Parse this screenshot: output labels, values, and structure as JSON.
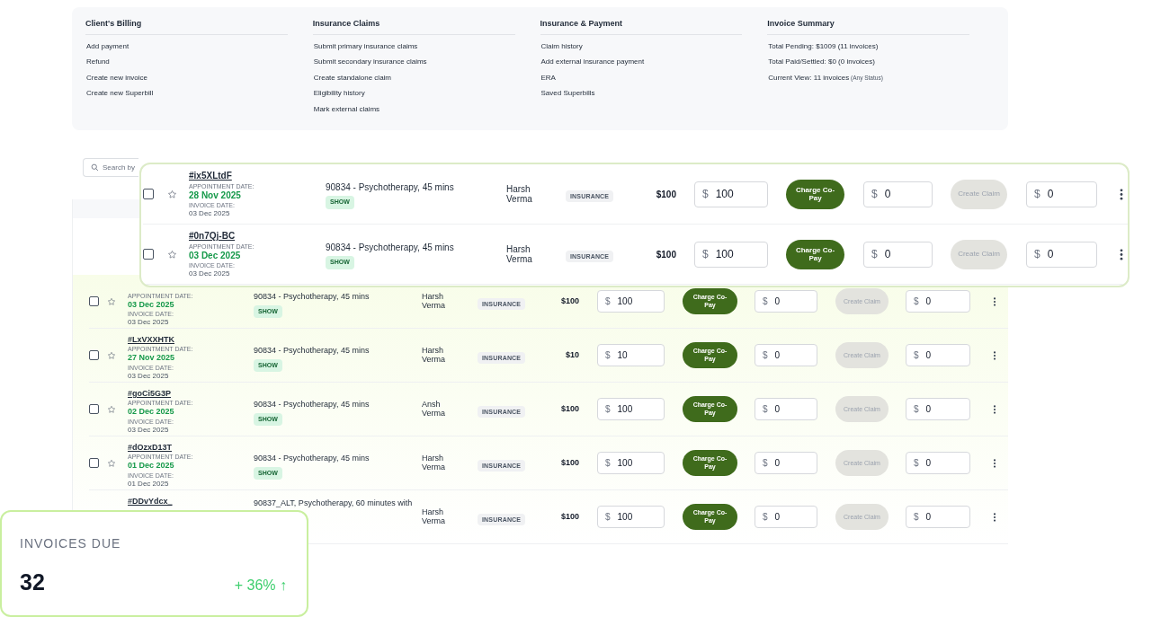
{
  "menu": {
    "sections": [
      {
        "title": "Client's Billing",
        "items": [
          {
            "text": "Add payment"
          },
          {
            "text": "Refund"
          },
          {
            "text": "Create new invoice"
          },
          {
            "text": "Create new Superbill"
          }
        ]
      },
      {
        "title": "Insurance Claims",
        "items": [
          {
            "text": "Submit primary insurance claims"
          },
          {
            "text": "Submit secondary insurance claims"
          },
          {
            "text": "Create standalone claim"
          },
          {
            "text": "Eligibility history"
          },
          {
            "text": "Mark external claims"
          }
        ]
      },
      {
        "title": "Insurance & Payment",
        "items": [
          {
            "text": "Claim history"
          },
          {
            "text": "Add external insurance payment"
          },
          {
            "text": "ERA"
          },
          {
            "text": "Saved Superbills"
          }
        ]
      },
      {
        "title": "Invoice Summary",
        "items": [
          {
            "text": "Total Pending: $1009 (11 invoices)"
          },
          {
            "text": "Total Paid/Settled: $0 (0 invoices)"
          },
          {
            "text": "Current View: 11 invoices",
            "note": "(Any Status)"
          }
        ]
      }
    ]
  },
  "toolbar": {
    "search": {
      "placeholder": "Search by"
    }
  },
  "table": {
    "rows": [
      {
        "checked": false,
        "starred": false,
        "appointment_label": "APPOINTMENT DATE:",
        "appointment_date": "03 Dec 2025",
        "invoice_label": "INVOICE DATE:",
        "invoice_date": "03 Dec 2025",
        "service": "90834 - Psychotherapy, 45 mins",
        "status": "SHOW",
        "provider": "Harsh Verma",
        "payer": "INSURANCE",
        "amount": "$100",
        "currency_1": "$",
        "copay": "100",
        "charge_label": "Charge Co-Pay",
        "currency_2": "$",
        "field_2": "0",
        "claim_label": "Create Claim",
        "claim_disabled": true,
        "currency_3": "$",
        "field_3": "0"
      },
      {
        "id": "#LxVXXHTK",
        "checked": false,
        "starred": false,
        "appointment_label": "APPOINTMENT DATE:",
        "appointment_date": "27 Nov 2025",
        "invoice_label": "INVOICE DATE:",
        "invoice_date": "03 Dec 2025",
        "service": "90834 - Psychotherapy, 45 mins",
        "status": "SHOW",
        "provider": "Harsh Verma",
        "payer": "INSURANCE",
        "amount": "$10",
        "currency_1": "$",
        "copay": "10",
        "charge_label": "Charge Co-Pay",
        "currency_2": "$",
        "field_2": "0",
        "claim_label": "Create Claim",
        "claim_disabled": true,
        "currency_3": "$",
        "field_3": "0"
      },
      {
        "id": "#goCi5G3P",
        "checked": false,
        "starred": false,
        "appointment_label": "APPOINTMENT DATE:",
        "appointment_date": "02 Dec 2025",
        "invoice_label": "INVOICE DATE:",
        "invoice_date": "03 Dec 2025",
        "service": "90834 - Psychotherapy, 45 mins",
        "status": "SHOW",
        "provider": "Ansh Verma",
        "payer": "INSURANCE",
        "amount": "$100",
        "currency_1": "$",
        "copay": "100",
        "charge_label": "Charge Co-Pay",
        "currency_2": "$",
        "field_2": "0",
        "claim_label": "Create Claim",
        "claim_disabled": true,
        "currency_3": "$",
        "field_3": "0"
      },
      {
        "id": "#dOzxD13T",
        "checked": false,
        "starred": false,
        "appointment_label": "APPOINTMENT DATE:",
        "appointment_date": "01 Dec 2025",
        "invoice_label": "INVOICE DATE:",
        "invoice_date": "01 Dec 2025",
        "service": "90834 - Psychotherapy, 45 mins",
        "status": "SHOW",
        "provider": "Harsh Verma",
        "payer": "INSURANCE",
        "amount": "$100",
        "currency_1": "$",
        "copay": "100",
        "charge_label": "Charge Co-Pay",
        "currency_2": "$",
        "field_2": "0",
        "claim_label": "Create Claim",
        "claim_disabled": true,
        "currency_3": "$",
        "field_3": "0"
      },
      {
        "id": "#DDvYdcx_",
        "service": "90837_ALT, Psychotherapy, 60 minutes with",
        "provider": "Harsh Verma",
        "payer": "INSURANCE",
        "amount": "$100",
        "currency_1": "$",
        "copay": "100",
        "charge_label": "Charge Co-Pay",
        "currency_2": "$",
        "field_2": "0",
        "claim_label": "Create Claim",
        "claim_disabled": true,
        "currency_3": "$",
        "field_3": "0"
      }
    ]
  },
  "highlight_card": {
    "rows": [
      {
        "id": "#ix5XLtdF",
        "checked": false,
        "starred": false,
        "appointment_label": "APPOINTMENT DATE:",
        "appointment_date": "28 Nov 2025",
        "invoice_label": "INVOICE DATE:",
        "invoice_date": "03 Dec 2025",
        "service": "90834 - Psychotherapy, 45 mins",
        "status": "SHOW",
        "provider": "Harsh Verma",
        "payer": "INSURANCE",
        "amount": "$100",
        "currency_1": "$",
        "copay": "100",
        "charge_label": "Charge Co-Pay",
        "currency_2": "$",
        "field_2": "0",
        "claim_label": "Create Claim",
        "claim_disabled": true,
        "currency_3": "$",
        "field_3": "0"
      },
      {
        "id": "#0n7Qj-BC",
        "checked": false,
        "starred": false,
        "appointment_label": "APPOINTMENT DATE:",
        "appointment_date": "03 Dec 2025",
        "invoice_label": "INVOICE DATE:",
        "invoice_date": "03 Dec 2025",
        "service": "90834 - Psychotherapy, 45 mins",
        "status": "SHOW",
        "provider": "Harsh Verma",
        "payer": "INSURANCE",
        "amount": "$100",
        "currency_1": "$",
        "copay": "100",
        "charge_label": "Charge Co-Pay",
        "currency_2": "$",
        "field_2": "0",
        "claim_label": "Create Claim",
        "claim_disabled": true,
        "currency_3": "$",
        "field_3": "0"
      }
    ]
  },
  "stat_card": {
    "label": "INVOICES DUE",
    "value": "32",
    "change": "+ 36% ↑"
  }
}
